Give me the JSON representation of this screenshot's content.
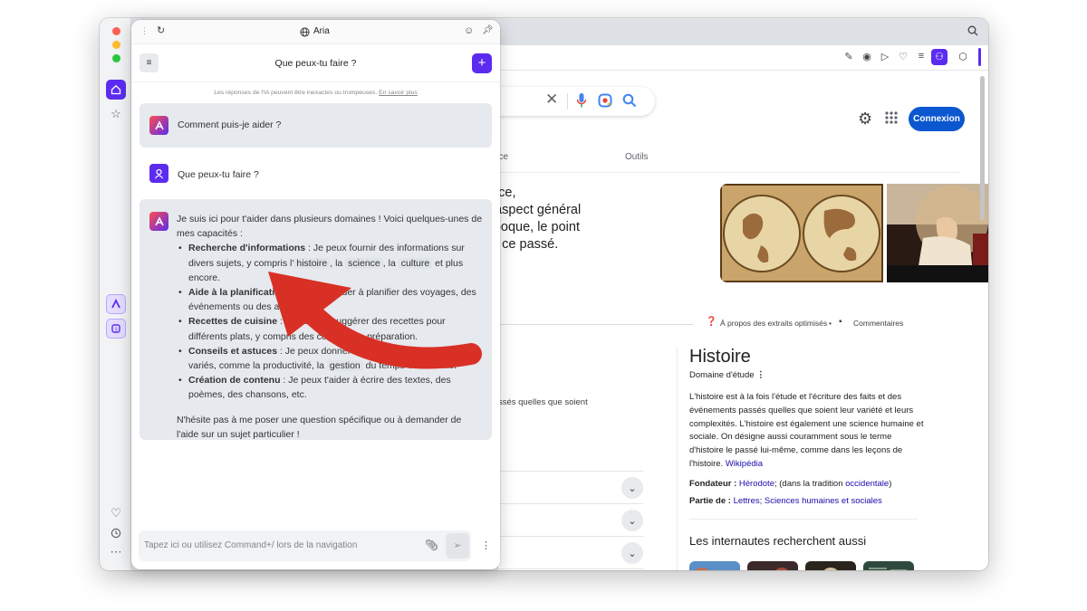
{
  "panel": {
    "title": "Aria",
    "header_title": "Que peux-tu faire ?",
    "disclaimer": "Les réponses de l'IA peuvent être inexactes ou trompeuses.",
    "disclaimer_link": "En savoir plus",
    "greeting": "Comment puis-je aider ?",
    "user_message": "Que peux-tu faire ?",
    "reply_intro": "Je suis ici pour t'aider dans plusieurs domaines ! Voici quelques-unes de mes capacités :",
    "items": [
      {
        "title": "Recherche d'informations",
        "text_a": " : Je peux fournir des informations sur divers sujets, y compris l'",
        "chip1": "histoire",
        "sep1": ", la ",
        "chip2": "science",
        "sep2": ", la ",
        "chip3": "culture",
        "text_b": " et plus encore."
      },
      {
        "title": "Aide à la planification",
        "text_a": " : Je peux t'aider à planifier des voyages, des événements ou des activités."
      },
      {
        "title": "Recettes de cuisine",
        "text_a": " : Je peux te suggérer des recettes pour différents plats, y compris des conseils de préparation."
      },
      {
        "title": "Conseils et astuces",
        "text_a": " : Je peux donner des conseils sur des sujets variés, comme la productivité, la ",
        "chip1": "gestion",
        "text_b": " du temps ou la santé."
      },
      {
        "title": "Création de contenu",
        "text_a": " : Je peux t'aider à écrire des textes, des poèmes, des chansons, etc."
      }
    ],
    "reply_outro": "N'hésite pas à me poser une question spécifique ou à demander de l'aide sur un sujet particulier !",
    "input_placeholder": "Tapez ici ou utilisez Command+/ lors de la navigation"
  },
  "google": {
    "tab_fragment": "nce",
    "tab_tools": "Outils",
    "signin": "Connexion",
    "snippet_lines": [
      "ence,",
      "n aspect général",
      "'époque, le point",
      "de ce passé."
    ],
    "snippet_about": "À propos des extraits optimisés",
    "snippet_feedback": "Commentaires",
    "body_fragment": "s passés quelles que soient",
    "kp": {
      "title": "Histoire",
      "subtitle": "Domaine d'étude",
      "description": "L'histoire est à la fois l'étude et l'écriture des faits et des événements passés quelles que soient leur variété et leurs complexités. L'histoire est également une science humaine et sociale. On désigne aussi couramment sous le terme d'histoire le passé lui-même, comme dans les leçons de l'histoire.",
      "source": "Wikipédia",
      "founder_label": "Fondateur :",
      "founder_value": "Hérodote",
      "founder_note_a": "; (dans la tradition ",
      "founder_note_link": "occidentale",
      "founder_note_b": ")",
      "part_label": "Partie de :",
      "part_value_a": "Lettres",
      "part_value_sep": "; ",
      "part_value_b": "Sciences humaines et sociales",
      "also_search": "Les internautes recherchent aussi"
    }
  },
  "icons": {
    "sidebar_top": [
      "home-icon",
      "star-icon"
    ],
    "sidebar_apps": [
      "aria-app-icon",
      "vpn-app-icon"
    ],
    "sidebar_bottom": [
      "heart-icon",
      "clock-icon",
      "more-icon"
    ]
  },
  "colors": {
    "accent": "#5b2cf0",
    "google_blue": "#0b57d0",
    "arrow_red": "#d93025"
  }
}
